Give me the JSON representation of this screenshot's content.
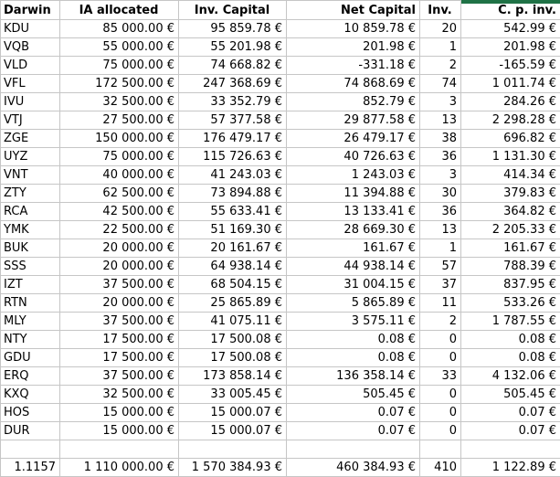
{
  "table": {
    "headers": [
      "Darwin",
      "IA allocated",
      "Inv. Capital",
      "Net Capital",
      "Inv.",
      "C. p. inv."
    ],
    "rows": [
      {
        "cells": [
          "KDU",
          "85 000.00 €",
          "95 859.78 €",
          "10 859.78 €",
          "20",
          "542.99 €"
        ]
      },
      {
        "cells": [
          "VQB",
          "55 000.00 €",
          "55 201.98 €",
          "201.98 €",
          "1",
          "201.98 €"
        ]
      },
      {
        "cells": [
          "VLD",
          "75 000.00 €",
          "74 668.82 €",
          "-331.18 €",
          "2",
          "-165.59 €"
        ]
      },
      {
        "cells": [
          "VFL",
          "172 500.00 €",
          "247 368.69 €",
          "74 868.69 €",
          "74",
          "1 011.74 €"
        ]
      },
      {
        "cells": [
          "IVU",
          "32 500.00 €",
          "33 352.79 €",
          "852.79 €",
          "3",
          "284.26 €"
        ]
      },
      {
        "cells": [
          "VTJ",
          "27 500.00 €",
          "57 377.58 €",
          "29 877.58 €",
          "13",
          "2 298.28 €"
        ]
      },
      {
        "cells": [
          "ZGE",
          "150 000.00 €",
          "176 479.17 €",
          "26 479.17 €",
          "38",
          "696.82 €"
        ]
      },
      {
        "cells": [
          "UYZ",
          "75 000.00 €",
          "115 726.63 €",
          "40 726.63 €",
          "36",
          "1 131.30 €"
        ]
      },
      {
        "cells": [
          "VNT",
          "40 000.00 €",
          "41 243.03 €",
          "1 243.03 €",
          "3",
          "414.34 €"
        ]
      },
      {
        "cells": [
          "ZTY",
          "62 500.00 €",
          "73 894.88 €",
          "11 394.88 €",
          "30",
          "379.83 €"
        ]
      },
      {
        "cells": [
          "RCA",
          "42 500.00 €",
          "55 633.41 €",
          "13 133.41 €",
          "36",
          "364.82 €"
        ]
      },
      {
        "cells": [
          "YMK",
          "22 500.00 €",
          "51 169.30 €",
          "28 669.30 €",
          "13",
          "2 205.33 €"
        ]
      },
      {
        "cells": [
          "BUK",
          "20 000.00 €",
          "20 161.67 €",
          "161.67 €",
          "1",
          "161.67 €"
        ]
      },
      {
        "cells": [
          "SSS",
          "20 000.00 €",
          "64 938.14 €",
          "44 938.14 €",
          "57",
          "788.39 €"
        ]
      },
      {
        "cells": [
          "IZT",
          "37 500.00 €",
          "68 504.15 €",
          "31 004.15 €",
          "37",
          "837.95 €"
        ]
      },
      {
        "cells": [
          "RTN",
          "20 000.00 €",
          "25 865.89 €",
          "5 865.89 €",
          "11",
          "533.26 €"
        ]
      },
      {
        "cells": [
          "MLY",
          "37 500.00 €",
          "41 075.11 €",
          "3 575.11 €",
          "2",
          "1 787.55 €"
        ]
      },
      {
        "cells": [
          "NTY",
          "17 500.00 €",
          "17 500.08 €",
          "0.08 €",
          "0",
          "0.08 €"
        ]
      },
      {
        "cells": [
          "GDU",
          "17 500.00 €",
          "17 500.08 €",
          "0.08 €",
          "0",
          "0.08 €"
        ]
      },
      {
        "cells": [
          "ERQ",
          "37 500.00 €",
          "173 858.14 €",
          "136 358.14 €",
          "33",
          "4 132.06 €"
        ]
      },
      {
        "cells": [
          "KXQ",
          "32 500.00 €",
          "33 005.45 €",
          "505.45 €",
          "0",
          "505.45 €"
        ]
      },
      {
        "cells": [
          "HOS",
          "15 000.00 €",
          "15 000.07 €",
          "0.07 €",
          "0",
          "0.07 €"
        ]
      },
      {
        "cells": [
          "DUR",
          "15 000.00 €",
          "15 000.07 €",
          "0.07 €",
          "0",
          "0.07 €"
        ]
      }
    ],
    "total_row": {
      "cells": [
        "1.1157",
        "1 110 000.00 €",
        "1 570 384.93 €",
        "460 384.93 €",
        "410",
        "1 122.89 €"
      ]
    },
    "error_indicator": {
      "row_id": "ERQ",
      "column": "C. p. inv."
    }
  },
  "colors": {
    "gridline": "#c6c6c6",
    "selection_green_bar": "#1f7246",
    "error_triangle_green": "#149038"
  }
}
